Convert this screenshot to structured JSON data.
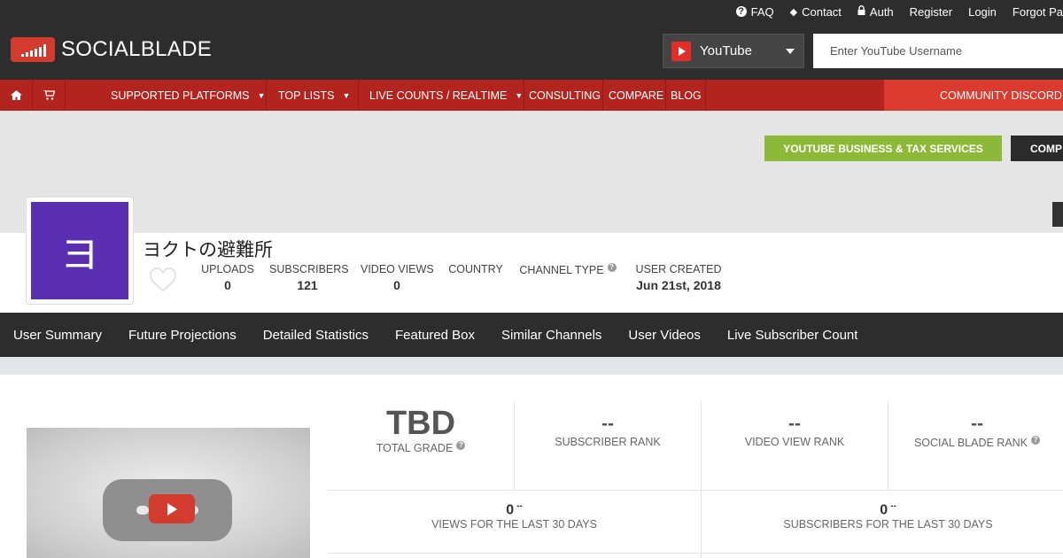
{
  "top_links": [
    {
      "label": "FAQ",
      "icon": "question-circle-icon"
    },
    {
      "label": "Contact",
      "icon": "tag-icon"
    },
    {
      "label": "Auth",
      "icon": "lock-icon"
    },
    {
      "label": "Register"
    },
    {
      "label": "Login"
    },
    {
      "label": "Forgot Pa"
    }
  ],
  "logo": {
    "text": "SOCIALBLADE"
  },
  "platform_select": {
    "selected": "YouTube"
  },
  "search": {
    "placeholder": "Enter YouTube Username"
  },
  "nav": {
    "items": [
      {
        "label": "SUPPORTED PLATFORMS",
        "dropdown": true
      },
      {
        "label": "TOP LISTS",
        "dropdown": true
      },
      {
        "label": "LIVE COUNTS / REALTIME",
        "dropdown": true
      },
      {
        "label": "CONSULTING"
      },
      {
        "label": "COMPARE"
      },
      {
        "label": "BLOG"
      }
    ],
    "community": "COMMUNITY DISCORD"
  },
  "banner": {
    "business_button": "YOUTUBE BUSINESS & TAX SERVICES",
    "compare_button": "COMP"
  },
  "profile": {
    "avatar_letter": "ヨ",
    "channel_name": "ヨクトの避難所",
    "stats": {
      "uploads": {
        "label": "UPLOADS",
        "value": "0"
      },
      "subscribers": {
        "label": "SUBSCRIBERS",
        "value": "121"
      },
      "video_views": {
        "label": "VIDEO VIEWS",
        "value": "0"
      },
      "country": {
        "label": "COUNTRY",
        "value": ""
      },
      "channel_type": {
        "label": "CHANNEL TYPE",
        "value": ""
      },
      "user_created": {
        "label": "USER CREATED",
        "value": "Jun 21st, 2018"
      }
    }
  },
  "tabs": [
    "User Summary",
    "Future Projections",
    "Detailed Statistics",
    "Featured Box",
    "Similar Channels",
    "User Videos",
    "Live Subscriber Count"
  ],
  "grades": {
    "total_grade": {
      "value": "TBD",
      "label": "TOTAL GRADE"
    },
    "subscriber_rank": {
      "value": "--",
      "label": "SUBSCRIBER RANK"
    },
    "video_view_rank": {
      "value": "--",
      "label": "VIDEO VIEW RANK"
    },
    "social_blade_rank": {
      "value": "--",
      "label": "SOCIAL BLADE RANK"
    },
    "views_30": {
      "value": "0",
      "delta": "--",
      "label": "VIEWS FOR THE LAST 30 DAYS"
    },
    "subs_30": {
      "value": "0",
      "delta": "--",
      "label": "SUBSCRIBERS FOR THE LAST 30 DAYS"
    }
  },
  "colors": {
    "brand_red": "#b3241f",
    "accent_green": "#8cb937",
    "avatar_purple": "#5a2eb0",
    "dark": "#2d2d2d"
  }
}
